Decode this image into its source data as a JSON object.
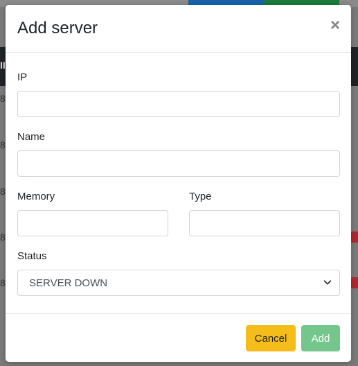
{
  "dialog": {
    "title": "Add server",
    "close_symbol": "×"
  },
  "form": {
    "ip_label": "IP",
    "ip_value": "",
    "name_label": "Name",
    "name_value": "",
    "memory_label": "Memory",
    "memory_value": "",
    "type_label": "Type",
    "type_value": "",
    "status_label": "Status",
    "status_value": "SERVER DOWN"
  },
  "footer": {
    "cancel_label": "Cancel",
    "add_label": "Add"
  },
  "background": {
    "row_marker": "8",
    "header_marker": "II"
  },
  "colors": {
    "cancel_button": "#f5bd1a",
    "add_button": "#74c68c"
  },
  "icons": {
    "close": "close-icon",
    "select_arrow": "chevron-down-icon"
  }
}
